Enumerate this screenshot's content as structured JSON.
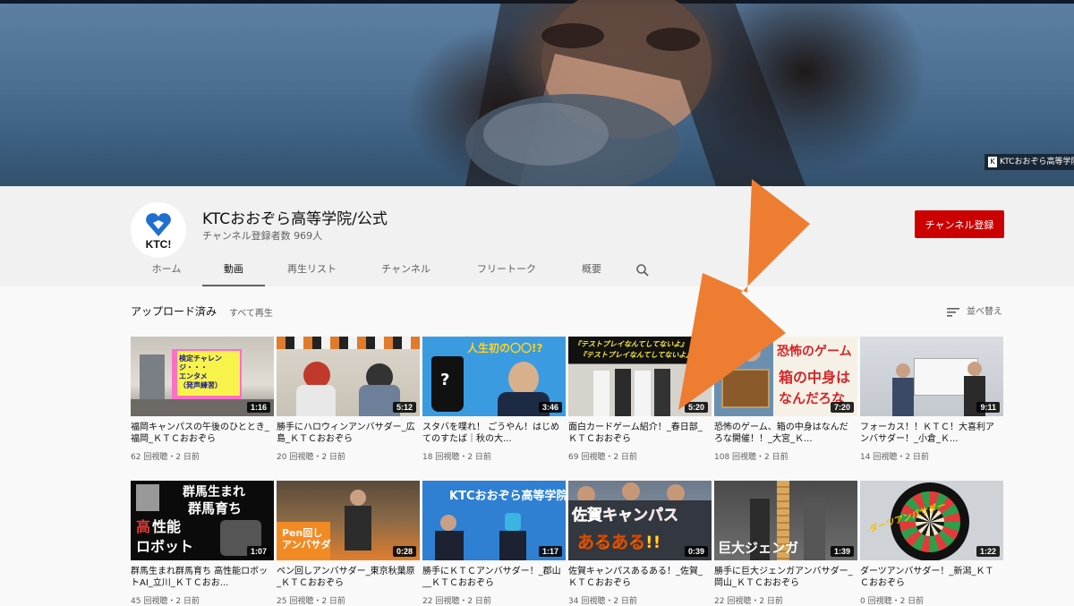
{
  "banner": {
    "logo_text": "KTCおおぞら高等学院"
  },
  "channel": {
    "avatar_text": "KTC!",
    "name": "KTCおおぞら高等学院/公式",
    "subscribers": "チャンネル登録者数 969人",
    "subscribe_label": "チャンネル登録"
  },
  "tabs": [
    {
      "label": "ホーム"
    },
    {
      "label": "動画",
      "active": true
    },
    {
      "label": "再生リスト"
    },
    {
      "label": "チャンネル"
    },
    {
      "label": "フリートーク"
    },
    {
      "label": "概要"
    }
  ],
  "shelf": {
    "title": "アップロード済み",
    "play_all": "すべて再生",
    "sort_label": "並べ替え"
  },
  "thumb_text": {
    "v1": "検定チャレン\nジ・・・\nエンタメ\n（発声練習）",
    "v3": "人生初の〇〇!?",
    "v4a": "『テストプレイなんてしてないよ』",
    "v4b": "『テストプレイなんてしてないよ』無",
    "v5a": "恐怖のゲーム",
    "v5b": "箱の中身は",
    "v5c": "なんだろな",
    "v7a": "群馬生まれ",
    "v7b": "群馬育ち",
    "v7c": "高",
    "v7d": "性能",
    "v7e": "ロボット",
    "v8": "Pen回し\nアンバサダ",
    "v9": "KTCおおぞら高等学院",
    "v10a": "佐賀キャンパス",
    "v10b": "あるある!!",
    "v11": "巨大ジェンガ",
    "v12": "ダーツアンバサダー"
  },
  "videos": [
    {
      "title": "福岡キャンパスの午後のひととき_福岡_ＫＴＣおおぞら",
      "duration": "1:16",
      "meta": "62 回視聴・2 日前"
    },
    {
      "title": "勝手にハロウィンアンバサダー_広島_ＫＴＣおおぞら",
      "duration": "5:12",
      "meta": "20 回視聴・2 日前"
    },
    {
      "title": "スタバを喋れ！ ごうやん！はじめてのすたば｜秋の大...",
      "duration": "3:46",
      "meta": "18 回視聴・2 日前"
    },
    {
      "title": "面白カードゲーム紹介！_春日部_ＫＴＣおおぞら",
      "duration": "5:20",
      "meta": "69 回視聴・2 日前"
    },
    {
      "title": "恐怖のゲーム、箱の中身はなんだろな開催！！_大宮_Ｋ...",
      "duration": "7:20",
      "meta": "108 回視聴・2 日前"
    },
    {
      "title": "フォーカス！！ＫＴＣ！大喜利アンバサダー！_小倉_Ｋ...",
      "duration": "9:11",
      "meta": "14 回視聴・2 日前"
    },
    {
      "title": "群馬生まれ群馬育ち 高性能ロボットAI_立川_ＫＴＣおお...",
      "duration": "1:07",
      "meta": "45 回視聴・2 日前"
    },
    {
      "title": "ペン回しアンバサダー_東京秋葉原_ＫＴＣおおぞら",
      "duration": "0:28",
      "meta": "25 回視聴・2 日前"
    },
    {
      "title": "勝手にＫＴＣアンバサダー！_郡山__ＫＴＣおおぞら",
      "duration": "1:17",
      "meta": "22 回視聴・2 日前"
    },
    {
      "title": "佐賀キャンパスあるある！_佐賀_ＫＴＣおおぞら",
      "duration": "0:39",
      "meta": "34 回視聴・2 日前"
    },
    {
      "title": "勝手に巨大ジェンガアンバサダー_岡山_ＫＴＣおおぞら",
      "duration": "1:39",
      "meta": "22 回視聴・2 日前"
    },
    {
      "title": "ダーツアンバサダー！_新潟_ＫＴＣおおぞら",
      "duration": "1:22",
      "meta": "0 回視聴・2 日前"
    }
  ],
  "colors": {
    "subscribe": "#cc0000",
    "arrow": "#ee7d31",
    "background": "#f9f9f9"
  }
}
